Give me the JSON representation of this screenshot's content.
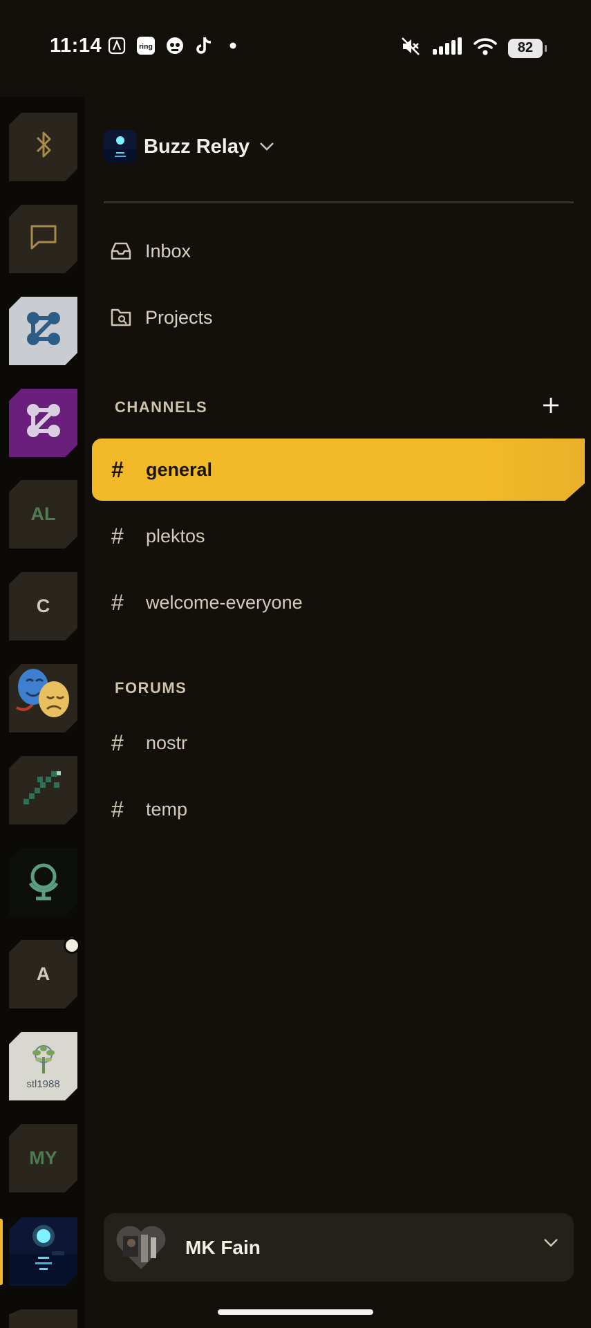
{
  "status_bar": {
    "time": "11:14",
    "ring_label": "ring",
    "battery": "82",
    "icons": [
      "app-a-icon",
      "ring-icon",
      "skull-icon",
      "tiktok-icon",
      "dot-icon",
      "mute-icon",
      "signal-icon",
      "wifi-icon",
      "battery-icon"
    ]
  },
  "server_rail": {
    "servers": [
      {
        "name": "bluetooth-server",
        "icon": "bluetooth-icon"
      },
      {
        "name": "messages-server",
        "icon": "chat-icon"
      },
      {
        "name": "network-server-light",
        "icon": "network-icon"
      },
      {
        "name": "network-server-purple",
        "icon": "network-icon"
      },
      {
        "name": "al-server",
        "label": "AL"
      },
      {
        "name": "c-server",
        "label": "C"
      },
      {
        "name": "theater-server",
        "icon": "theater-masks-icon"
      },
      {
        "name": "dragonfly-server",
        "icon": "dragonfly-icon"
      },
      {
        "name": "globe-server",
        "icon": "globe-icon"
      },
      {
        "name": "a-server",
        "label": "A"
      },
      {
        "name": "stl1988-server",
        "label": "stl1988"
      },
      {
        "name": "my-server",
        "label": "MY"
      },
      {
        "name": "buzz-relay-server",
        "icon": "night-sea-icon"
      }
    ],
    "accent_color": "#f0b92c"
  },
  "workspace": {
    "name": "Buzz Relay"
  },
  "nav": {
    "inbox": "Inbox",
    "projects": "Projects"
  },
  "channels": {
    "title": "CHANNELS",
    "items": [
      {
        "name": "general",
        "active": true
      },
      {
        "name": "plektos",
        "active": false
      },
      {
        "name": "welcome-everyone",
        "active": false
      }
    ]
  },
  "forums": {
    "title": "FORUMS",
    "items": [
      {
        "name": "nostr"
      },
      {
        "name": "temp"
      }
    ]
  },
  "user": {
    "name": "MK Fain"
  },
  "colors": {
    "background": "#13100b",
    "active_channel": "#f2b928",
    "rail": "#0c0a07"
  }
}
